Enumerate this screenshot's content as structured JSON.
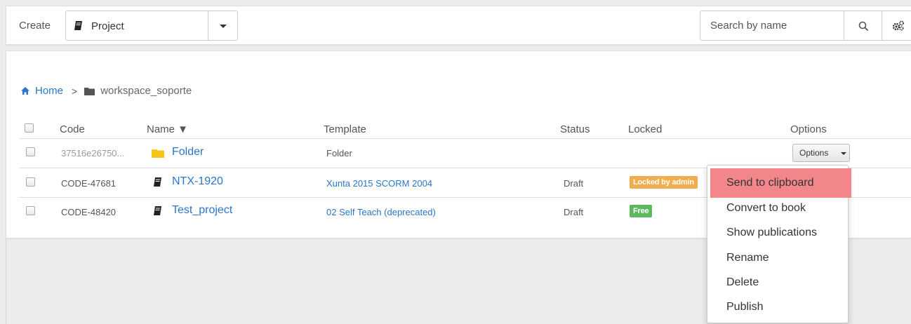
{
  "toolbar": {
    "create_label": "Create",
    "type_select_value": "Project",
    "search_placeholder": "Search by name"
  },
  "breadcrumb": {
    "home": "Home",
    "separator": ">",
    "current": "workspace_soporte"
  },
  "table": {
    "headers": {
      "code": "Code",
      "name": "Name ▼",
      "template": "Template",
      "status": "Status",
      "locked": "Locked",
      "options": "Options"
    },
    "rows": [
      {
        "code": "37516e26750...",
        "icon": "folder-icon",
        "name": "Folder",
        "template": "Folder",
        "status": "",
        "locked": ""
      },
      {
        "code": "CODE-47681",
        "icon": "book-icon",
        "name": "NTX-1920",
        "template": "Xunta 2015 SCORM 2004",
        "status": "Draft",
        "locked": "Locked by admin"
      },
      {
        "code": "CODE-48420",
        "icon": "book-icon",
        "name": "Test_project",
        "template": "02 Self Teach (deprecated)",
        "status": "Draft",
        "locked": "Free"
      }
    ],
    "options_button": "Options"
  },
  "options_menu": {
    "items": [
      "Send to clipboard",
      "Convert to book",
      "Show publications",
      "Rename",
      "Delete",
      "Publish"
    ],
    "highlighted": "Send to clipboard"
  },
  "colors": {
    "link": "#2a77c9",
    "locked_badge": "#f0ad4e",
    "free_badge": "#5cb85c",
    "menu_highlight": "#f2868a",
    "folder": "#f5c518"
  }
}
